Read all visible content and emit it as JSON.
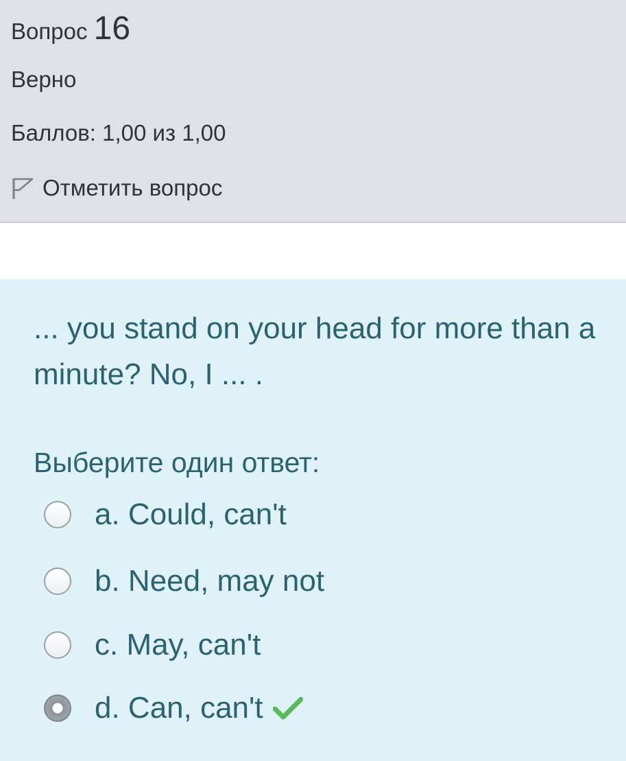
{
  "question_info": {
    "label": "Вопрос",
    "number": "16",
    "state": "Верно",
    "grade": "Баллов: 1,00 из 1,00",
    "flag_label": "Отметить вопрос",
    "flag_icon": "flag-icon"
  },
  "question": {
    "text": "... you stand on your head for more than a minute? No, I ... .",
    "prompt": "Выберите один ответ:",
    "answers": [
      {
        "label": "a. Could, can't",
        "selected": false
      },
      {
        "label": "b. Need, may not",
        "selected": false
      },
      {
        "label": "c. May, can't",
        "selected": false
      },
      {
        "label": "d. Can, can't",
        "selected": true,
        "correct": true
      }
    ],
    "correct_icon": "check-icon"
  },
  "colors": {
    "info_background": "#dee2e6",
    "content_background": "#def2f8",
    "content_text": "#2b6271",
    "correct_mark": "#5cb85c"
  }
}
